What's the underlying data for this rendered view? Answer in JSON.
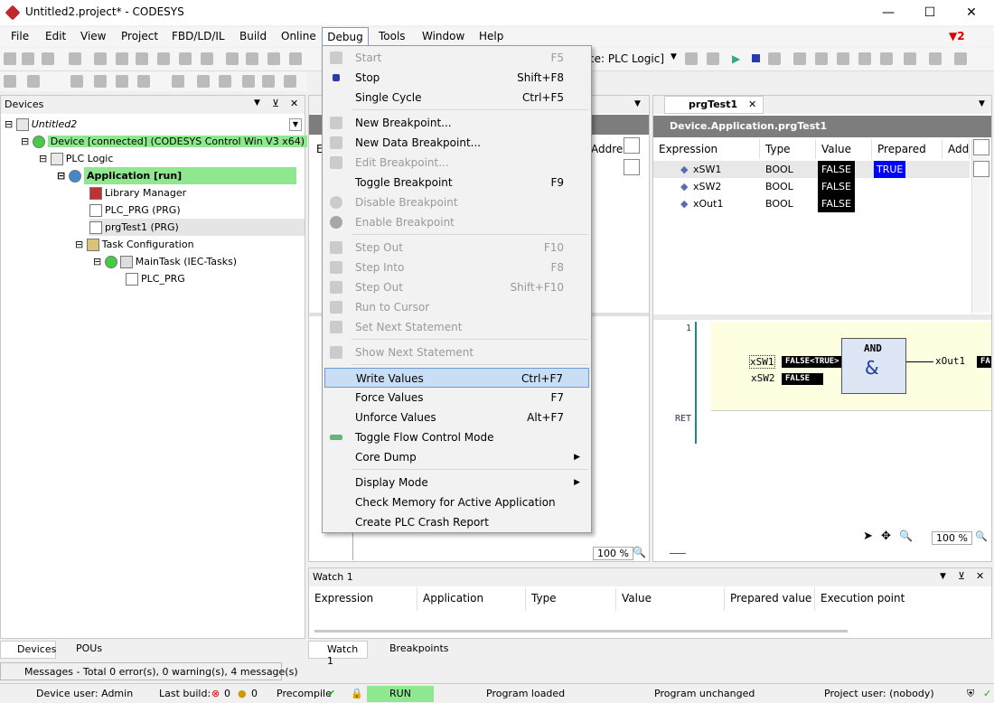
{
  "window": {
    "title": "Untitled2.project* - CODESYS",
    "min": "—",
    "max": "☐",
    "close": "✕"
  },
  "menu": {
    "items": [
      "File",
      "Edit",
      "View",
      "Project",
      "FBD/LD/IL",
      "Build",
      "Online",
      "Debug",
      "Tools",
      "Window",
      "Help"
    ],
    "flag_count": "2"
  },
  "toolbar": {
    "device_label": "ce: PLC Logic]"
  },
  "devices_panel": {
    "title": "Devices",
    "pin": "⊻",
    "close": "✕",
    "tree": [
      "Untitled2",
      "Device [connected] (CODESYS Control Win V3 x64)",
      "PLC Logic",
      "Application [run]",
      "Library Manager",
      "PLC_PRG (PRG)",
      "prgTest1 (PRG)",
      "Task Configuration",
      "MainTask (IEC-Tasks)",
      "PLC_PRG"
    ],
    "tabs": [
      "Devices",
      "POUs"
    ]
  },
  "debug_menu": {
    "items": [
      {
        "label": "Start",
        "shortcut": "F5",
        "disabled": true
      },
      {
        "label": "Stop",
        "shortcut": "Shift+F8",
        "disabled": false
      },
      {
        "label": "Single Cycle",
        "shortcut": "Ctrl+F5",
        "disabled": false
      },
      {
        "label": "New Breakpoint...",
        "shortcut": "",
        "disabled": false
      },
      {
        "label": "New Data Breakpoint...",
        "shortcut": "",
        "disabled": false
      },
      {
        "label": "Edit Breakpoint...",
        "shortcut": "",
        "disabled": true
      },
      {
        "label": "Toggle Breakpoint",
        "shortcut": "F9",
        "disabled": false
      },
      {
        "label": "Disable Breakpoint",
        "shortcut": "",
        "disabled": true
      },
      {
        "label": "Enable Breakpoint",
        "shortcut": "",
        "disabled": true
      },
      {
        "label": "Step Out",
        "shortcut": "F10",
        "disabled": true
      },
      {
        "label": "Step Into",
        "shortcut": "F8",
        "disabled": true
      },
      {
        "label": "Step Out",
        "shortcut": "Shift+F10",
        "disabled": true
      },
      {
        "label": "Run to Cursor",
        "shortcut": "",
        "disabled": true
      },
      {
        "label": "Set Next Statement",
        "shortcut": "",
        "disabled": true
      },
      {
        "label": "Show Next Statement",
        "shortcut": "",
        "disabled": true
      },
      {
        "label": "Write Values",
        "shortcut": "Ctrl+F7",
        "disabled": false
      },
      {
        "label": "Force Values",
        "shortcut": "F7",
        "disabled": false
      },
      {
        "label": "Unforce Values",
        "shortcut": "Alt+F7",
        "disabled": false
      },
      {
        "label": "Toggle Flow Control Mode",
        "shortcut": "",
        "disabled": false
      },
      {
        "label": "Core Dump",
        "shortcut": "",
        "disabled": false
      },
      {
        "label": "Display Mode",
        "shortcut": "",
        "disabled": false
      },
      {
        "label": "Check Memory for Active Application",
        "shortcut": "",
        "disabled": false
      },
      {
        "label": "Create PLC Crash Report",
        "shortcut": "",
        "disabled": false
      }
    ]
  },
  "left_editor": {
    "col_e": "E",
    "col_address": "Address",
    "zoom": "100 %"
  },
  "editor": {
    "tab": "prgTest1",
    "path": "Device.Application.prgTest1",
    "columns": [
      "Expression",
      "Type",
      "Value",
      "Prepared v...",
      "Add"
    ],
    "rows": [
      {
        "expr": "xSW1",
        "type": "BOOL",
        "value": "FALSE",
        "prepared": "TRUE"
      },
      {
        "expr": "xSW2",
        "type": "BOOL",
        "value": "FALSE",
        "prepared": ""
      },
      {
        "expr": "xOut1",
        "type": "BOOL",
        "value": "FALSE",
        "prepared": ""
      }
    ],
    "fbd": {
      "line1": "1",
      "ret": "RET",
      "block": "AND",
      "amp": "&",
      "in1": "xSW1",
      "in1val": "FALSE<TRUE>",
      "in2": "xSW2",
      "in2val": "FALSE",
      "out": "xOut1",
      "outval": "FA"
    },
    "zoom": "100 %"
  },
  "watch": {
    "title": "Watch 1",
    "columns": [
      "Expression",
      "Application",
      "Type",
      "Value",
      "Prepared value",
      "Execution point"
    ],
    "tabs": [
      "Watch 1",
      "Breakpoints"
    ]
  },
  "messages": "Messages - Total 0 error(s), 0 warning(s), 4 message(s)",
  "status": {
    "device_user": "Device user: Admin",
    "last_build": "Last build:",
    "errors": "0",
    "warnings": "0",
    "precompile": "Precompile",
    "run": "RUN",
    "program_loaded": "Program loaded",
    "program_unchanged": "Program unchanged",
    "project_user": "Project user: (nobody)"
  },
  "colors": {
    "green": "#8fe88f",
    "blue_prep": "#0000ff",
    "menu_sel": "#c9def5"
  }
}
